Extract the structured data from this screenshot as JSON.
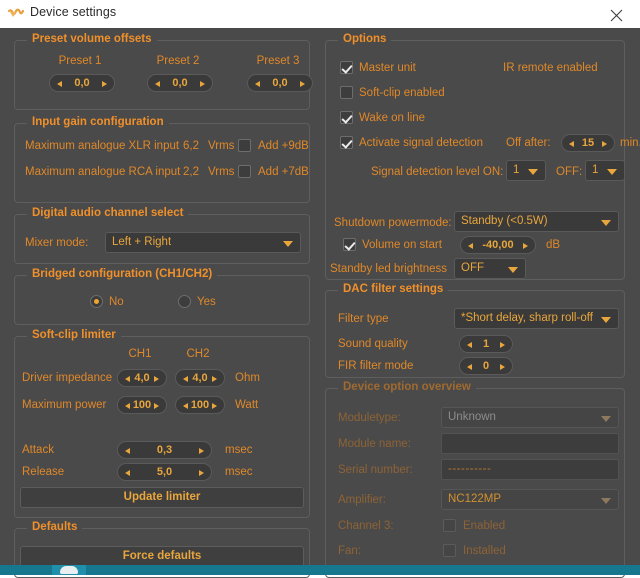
{
  "window": {
    "title": "Device settings",
    "icon": "app-logo-icon",
    "close_label": "close-icon"
  },
  "preset_volume_offsets": {
    "legend": "Preset volume offsets",
    "presets": [
      {
        "label": "Preset 1",
        "value": "0,0"
      },
      {
        "label": "Preset 2",
        "value": "0,0"
      },
      {
        "label": "Preset 3",
        "value": "0,0"
      }
    ]
  },
  "input_gain": {
    "legend": "Input gain configuration",
    "rows": [
      {
        "label": "Maximum analogue XLR input",
        "value": "6,2",
        "unit": "Vrms",
        "add_label": "Add +9dB",
        "add_checked": false
      },
      {
        "label": "Maximum analogue RCA input",
        "value": "2,2",
        "unit": "Vrms",
        "add_label": "Add +7dB",
        "add_checked": false
      }
    ]
  },
  "digital_audio": {
    "legend": "Digital audio channel select",
    "mixer_label": "Mixer mode:",
    "mixer_value": "Left + Right"
  },
  "bridged": {
    "legend": "Bridged configuration (CH1/CH2)",
    "options": [
      {
        "label": "No",
        "selected": true
      },
      {
        "label": "Yes",
        "selected": false
      }
    ]
  },
  "soft_clip_limiter": {
    "legend": "Soft-clip limiter",
    "ch1_header": "CH1",
    "ch2_header": "CH2",
    "driver_impedance_label": "Driver impedance",
    "driver_impedance_ch1": "4,0",
    "driver_impedance_ch2": "4,0",
    "driver_impedance_unit": "Ohm",
    "maximum_power_label": "Maximum power",
    "maximum_power_ch1": "100",
    "maximum_power_ch2": "100",
    "maximum_power_unit": "Watt",
    "attack_label": "Attack",
    "attack_value": "0,3",
    "attack_unit": "msec",
    "release_label": "Release",
    "release_value": "5,0",
    "release_unit": "msec",
    "update_button": "Update limiter"
  },
  "defaults": {
    "legend": "Defaults",
    "force_button": "Force defaults"
  },
  "options": {
    "legend": "Options",
    "master_unit": {
      "label": "Master unit",
      "checked": true
    },
    "ir_remote": "IR remote enabled",
    "soft_clip_enabled": {
      "label": "Soft-clip enabled",
      "checked": false
    },
    "wake_on_line": {
      "label": "Wake on line",
      "checked": true
    },
    "activate_signal_detection": {
      "label": "Activate signal detection",
      "checked": true
    },
    "off_after_label": "Off after:",
    "off_after_value": "15",
    "off_after_unit": "min.",
    "signal_level_label": "Signal detection level ON:",
    "signal_level_on": "1",
    "signal_level_off_label": "OFF:",
    "signal_level_off": "1",
    "shutdown_label": "Shutdown powermode:",
    "shutdown_value": "Standby (<0.5W)",
    "volume_on_start": {
      "label": "Volume on start",
      "checked": true
    },
    "volume_on_start_value": "-40,00",
    "volume_on_start_unit": "dB",
    "standby_led_label": "Standby led brightness",
    "standby_led_value": "OFF"
  },
  "dac_filter": {
    "legend": "DAC filter settings",
    "filter_type_label": "Filter type",
    "filter_type_value": "*Short delay, sharp roll-off",
    "sound_quality_label": "Sound quality",
    "sound_quality_value": "1",
    "fir_filter_label": "FIR filter mode",
    "fir_filter_value": "0"
  },
  "device_overview": {
    "legend": "Device option overview",
    "moduletype_label": "Moduletype:",
    "moduletype_value": "Unknown",
    "module_name_label": "Module name:",
    "module_name_value": "",
    "serial_number_label": "Serial number:",
    "serial_number_value": "----------",
    "amplifier_label": "Amplifier:",
    "amplifier_value": "NC122MP",
    "channel3_label": "Channel 3:",
    "channel3_check_label": "Enabled",
    "channel3_checked": false,
    "fan_label": "Fan:",
    "fan_check_label": "Installed",
    "fan_checked": false
  },
  "colors": {
    "accent": "#e9a63c",
    "legend": "#f0902a",
    "background": "#4a4a4a",
    "taskbar": "#15788f"
  }
}
